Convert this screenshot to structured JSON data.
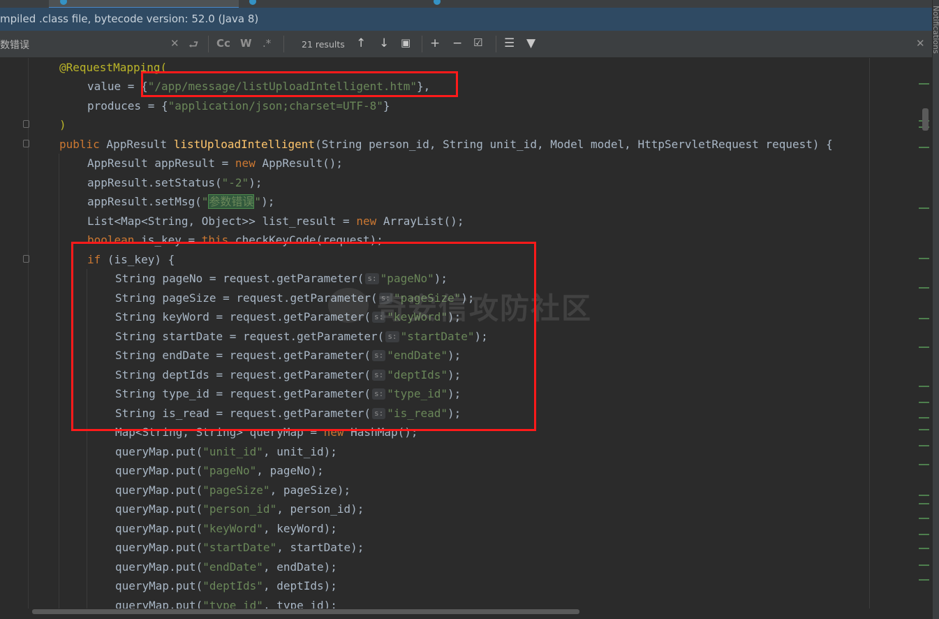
{
  "banner": {
    "text": "mpiled .class file, bytecode version: 52.0 (Java 8)"
  },
  "find": {
    "query": "数错误",
    "results": "21 results",
    "options": {
      "cc": "Cc",
      "w": "W",
      "regex": ".*"
    }
  },
  "side_panel": {
    "label": "Notifications"
  },
  "watermark": {
    "text": "奇安信攻防社区"
  },
  "code": {
    "l1": "@RequestMapping(",
    "l2_prefix": "value = ",
    "l2_open": "{",
    "l2_str": "\"/app/message/listUploadIntelligent.htm\"",
    "l2_close": "},",
    "l3_prefix": "produces = {",
    "l3_str": "\"application/json;charset=UTF-8\"",
    "l3_close": "}",
    "l4": ")",
    "l5_kw": "public",
    "l5_type": " AppResult ",
    "l5_fn": "listUploadIntelligent",
    "l5_rest": "(String person_id, String unit_id, Model model, HttpServletRequest request) {",
    "l6_a": "AppResult appResult = ",
    "l6_kw": "new",
    "l6_b": " AppResult();",
    "l7_a": "appResult.setStatus(",
    "l7_str": "\"-2\"",
    "l7_b": ");",
    "l8_a": "appResult.setMsg(",
    "l8_q1": "\"",
    "l8_hl": "参数错误",
    "l8_q2": "\"",
    "l8_b": ");",
    "l9_a": "List<Map<String, Object>> list_result = ",
    "l9_kw": "new",
    "l9_b": " ArrayList();",
    "l10_kw1": "boolean",
    "l10_a": " is_key = ",
    "l10_kw2": "this",
    "l10_b": ".checkKeyCode(request);",
    "l11_kw": "if",
    "l11_a": " (is_key) {",
    "hint": "s:",
    "params": [
      {
        "decl": "String pageNo = request.getParameter(",
        "str": "\"pageNo\"",
        "end": ");"
      },
      {
        "decl": "String pageSize = request.getParameter(",
        "str": "\"pageSize\"",
        "end": ");"
      },
      {
        "decl": "String keyWord = request.getParameter(",
        "str": "\"keyWord\"",
        "end": ");"
      },
      {
        "decl": "String startDate = request.getParameter(",
        "str": "\"startDate\"",
        "end": ");"
      },
      {
        "decl": "String endDate = request.getParameter(",
        "str": "\"endDate\"",
        "end": ");"
      },
      {
        "decl": "String deptIds = request.getParameter(",
        "str": "\"deptIds\"",
        "end": ");"
      },
      {
        "decl": "String type_id = request.getParameter(",
        "str": "\"type_id\"",
        "end": ");"
      },
      {
        "decl": "String is_read = request.getParameter(",
        "str": "\"is_read\"",
        "end": ");"
      }
    ],
    "l20_a": "Map<String, String> queryMap = ",
    "l20_kw": "new",
    "l20_b": " HashMap();",
    "puts": [
      {
        "a": "queryMap.put(",
        "str": "\"unit_id\"",
        "b": ", unit_id);"
      },
      {
        "a": "queryMap.put(",
        "str": "\"pageNo\"",
        "b": ", pageNo);"
      },
      {
        "a": "queryMap.put(",
        "str": "\"pageSize\"",
        "b": ", pageSize);"
      },
      {
        "a": "queryMap.put(",
        "str": "\"person_id\"",
        "b": ", person_id);"
      },
      {
        "a": "queryMap.put(",
        "str": "\"keyWord\"",
        "b": ", keyWord);"
      },
      {
        "a": "queryMap.put(",
        "str": "\"startDate\"",
        "b": ", startDate);"
      },
      {
        "a": "queryMap.put(",
        "str": "\"endDate\"",
        "b": ", endDate);"
      },
      {
        "a": "queryMap.put(",
        "str": "\"deptIds\"",
        "b": ", deptIds);"
      },
      {
        "a": "queryMap.put(",
        "str": "\"type_id\"",
        "b": ", type_id);"
      }
    ]
  }
}
